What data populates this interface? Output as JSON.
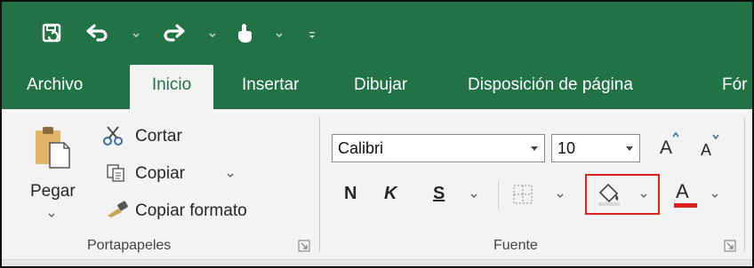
{
  "qat": {
    "icons": [
      "save-icon",
      "undo-icon",
      "redo-icon",
      "touch-mode-icon",
      "customize-qat-icon"
    ]
  },
  "tabs": [
    {
      "label": "Archivo",
      "active": false
    },
    {
      "label": "Inicio",
      "active": true
    },
    {
      "label": "Insertar",
      "active": false
    },
    {
      "label": "Dibujar",
      "active": false
    },
    {
      "label": "Disposición de página",
      "active": false
    },
    {
      "label": "Fór",
      "active": false
    }
  ],
  "clipboard": {
    "paste_label": "Pegar",
    "cut_label": "Cortar",
    "copy_label": "Copiar",
    "format_painter_label": "Copiar formato",
    "group_label": "Portapapeles"
  },
  "font": {
    "font_name": "Calibri",
    "font_size": "10",
    "grow_label": "A",
    "shrink_label": "A",
    "bold_label": "N",
    "italic_label": "K",
    "underline_label": "S",
    "font_color_label": "A",
    "group_label": "Fuente"
  },
  "colors": {
    "brand_green": "#217346",
    "highlight_box": "#e0201a",
    "font_color_bar": "#e0201a",
    "fill_color_bar": "#d9d9d9"
  }
}
